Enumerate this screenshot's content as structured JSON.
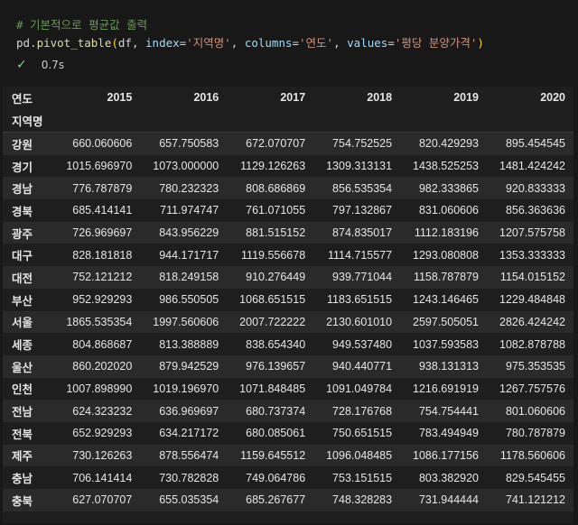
{
  "code": {
    "comment": "# 기본적으로 평균값 출력",
    "line2": {
      "obj": "pd.",
      "func": "pivot_table",
      "open": "(",
      "arg1": "df, ",
      "kw1": "index",
      "eq1": "=",
      "str1": "'지역명'",
      "sep1": ", ",
      "kw2": "columns",
      "eq2": "=",
      "str2": "'연도'",
      "sep2": ", ",
      "kw3": "values",
      "eq3": "=",
      "str3": "'평당 분양가격'",
      "close": ")"
    }
  },
  "status": {
    "icon": "check-icon",
    "time": "0.7s"
  },
  "table": {
    "columns_name": "연도",
    "index_name": "지역명",
    "columns": [
      "2015",
      "2016",
      "2017",
      "2018",
      "2019",
      "2020"
    ],
    "rows": [
      {
        "label": "강원",
        "values": [
          "660.060606",
          "657.750583",
          "672.070707",
          "754.752525",
          "820.429293",
          "895.454545"
        ]
      },
      {
        "label": "경기",
        "values": [
          "1015.696970",
          "1073.000000",
          "1129.126263",
          "1309.313131",
          "1438.525253",
          "1481.424242"
        ]
      },
      {
        "label": "경남",
        "values": [
          "776.787879",
          "780.232323",
          "808.686869",
          "856.535354",
          "982.333865",
          "920.833333"
        ]
      },
      {
        "label": "경북",
        "values": [
          "685.414141",
          "711.974747",
          "761.071055",
          "797.132867",
          "831.060606",
          "856.363636"
        ]
      },
      {
        "label": "광주",
        "values": [
          "726.969697",
          "843.956229",
          "881.515152",
          "874.835017",
          "1112.183196",
          "1207.575758"
        ]
      },
      {
        "label": "대구",
        "values": [
          "828.181818",
          "944.171717",
          "1119.556678",
          "1114.715577",
          "1293.080808",
          "1353.333333"
        ]
      },
      {
        "label": "대전",
        "values": [
          "752.121212",
          "818.249158",
          "910.276449",
          "939.771044",
          "1158.787879",
          "1154.015152"
        ]
      },
      {
        "label": "부산",
        "values": [
          "952.929293",
          "986.550505",
          "1068.651515",
          "1183.651515",
          "1243.146465",
          "1229.484848"
        ]
      },
      {
        "label": "서울",
        "values": [
          "1865.535354",
          "1997.560606",
          "2007.722222",
          "2130.601010",
          "2597.505051",
          "2826.424242"
        ]
      },
      {
        "label": "세종",
        "values": [
          "804.868687",
          "813.388889",
          "838.654340",
          "949.537480",
          "1037.593583",
          "1082.878788"
        ]
      },
      {
        "label": "울산",
        "values": [
          "860.202020",
          "879.942529",
          "976.139657",
          "940.440771",
          "938.131313",
          "975.353535"
        ]
      },
      {
        "label": "인천",
        "values": [
          "1007.898990",
          "1019.196970",
          "1071.848485",
          "1091.049784",
          "1216.691919",
          "1267.757576"
        ]
      },
      {
        "label": "전남",
        "values": [
          "624.323232",
          "636.969697",
          "680.737374",
          "728.176768",
          "754.754441",
          "801.060606"
        ]
      },
      {
        "label": "전북",
        "values": [
          "652.929293",
          "634.217172",
          "680.085061",
          "750.651515",
          "783.494949",
          "780.787879"
        ]
      },
      {
        "label": "제주",
        "values": [
          "730.126263",
          "878.556474",
          "1159.645512",
          "1096.048485",
          "1086.177156",
          "1178.560606"
        ]
      },
      {
        "label": "충남",
        "values": [
          "706.141414",
          "730.782828",
          "749.064786",
          "753.151515",
          "803.382920",
          "829.545455"
        ]
      },
      {
        "label": "충북",
        "values": [
          "627.070707",
          "655.035354",
          "685.267677",
          "748.328283",
          "731.944444",
          "741.121212"
        ]
      }
    ]
  }
}
